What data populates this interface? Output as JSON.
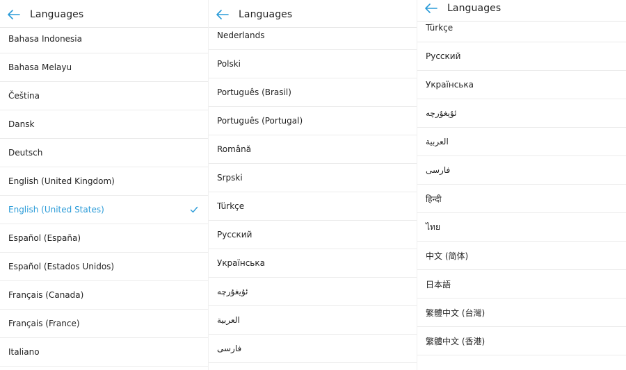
{
  "colors": {
    "accent": "#2a9bd8",
    "divider": "#ebebeb",
    "text": "#222222"
  },
  "screens": [
    {
      "header": {
        "title": "Languages",
        "back_icon": "arrow-left-icon"
      },
      "items": [
        {
          "label": "Bahasa Indonesia"
        },
        {
          "label": "Bahasa Melayu"
        },
        {
          "label": "Čeština"
        },
        {
          "label": "Dansk"
        },
        {
          "label": "Deutsch"
        },
        {
          "label": "English (United Kingdom)"
        },
        {
          "label": "English (United States)",
          "selected": true
        },
        {
          "label": "Español (España)"
        },
        {
          "label": "Español (Estados Unidos)"
        },
        {
          "label": "Français (Canada)"
        },
        {
          "label": "Français (France)"
        },
        {
          "label": "Italiano"
        }
      ]
    },
    {
      "header": {
        "title": "Languages",
        "back_icon": "arrow-left-icon"
      },
      "items": [
        {
          "label": "Nederlands"
        },
        {
          "label": "Polski"
        },
        {
          "label": "Português (Brasil)"
        },
        {
          "label": "Português (Portugal)"
        },
        {
          "label": "Română"
        },
        {
          "label": "Srpski"
        },
        {
          "label": "Türkçe"
        },
        {
          "label": "Русский"
        },
        {
          "label": "Українська"
        },
        {
          "label": "ئۇيغۇرچە",
          "rtl": true
        },
        {
          "label": "العربية",
          "rtl": true
        },
        {
          "label": "فارسی",
          "rtl": true
        }
      ]
    },
    {
      "header": {
        "title": "Languages",
        "back_icon": "arrow-left-icon"
      },
      "items": [
        {
          "label": "Türkçe"
        },
        {
          "label": "Русский"
        },
        {
          "label": "Українська"
        },
        {
          "label": "ئۇيغۇرچە",
          "rtl": true
        },
        {
          "label": "العربية",
          "rtl": true
        },
        {
          "label": "فارسی",
          "rtl": true
        },
        {
          "label": "हिन्दी"
        },
        {
          "label": "ไทย"
        },
        {
          "label": "中文 (简体)"
        },
        {
          "label": "日本語"
        },
        {
          "label": "繁體中文 (台灣)"
        },
        {
          "label": "繁體中文 (香港)"
        }
      ]
    }
  ]
}
